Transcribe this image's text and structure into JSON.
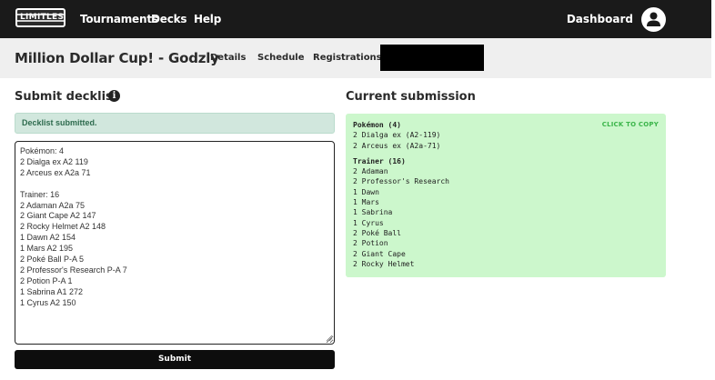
{
  "nav": {
    "logo_text": "LIMITLESS",
    "links": [
      "Tournaments",
      "Decks",
      "Help"
    ],
    "dashboard": "Dashboard",
    "user_icon": "user-icon"
  },
  "tournament": {
    "name": "Million Dollar Cup! - Godzly",
    "tabs": [
      "Details",
      "Schedule",
      "Registrations"
    ]
  },
  "submit_section": {
    "title": "Submit decklist",
    "info_icon": "info-icon",
    "alert": "Decklist submitted.",
    "decklist_value": "Pokémon: 4\n2 Dialga ex A2 119\n2 Arceus ex A2a 71\n\nTrainer: 16\n2 Adaman A2a 75\n2 Giant Cape A2 147\n2 Rocky Helmet A2 148\n1 Dawn A2 154\n1 Mars A2 195\n2 Poké Ball P-A 5\n2 Professor's Research P-A 7\n2 Potion P-A 1\n1 Sabrina A1 272\n1 Cyrus A2 150",
    "submit_label": "Submit"
  },
  "current_section": {
    "title": "Current submission",
    "copy_label": "CLICK TO COPY",
    "groups": [
      {
        "heading": "Pokémon (4)",
        "cards": [
          "2 Dialga ex (A2-119)",
          "2 Arceus ex (A2a-71)"
        ]
      },
      {
        "heading": "Trainer (16)",
        "cards": [
          "2 Adaman",
          "2 Professor's Research",
          "1 Dawn",
          "1 Mars",
          "1 Sabrina",
          "1 Cyrus",
          "2 Poké Ball",
          "2 Potion",
          "2 Giant Cape",
          "2 Rocky Helmet"
        ]
      }
    ]
  },
  "colors": {
    "nav_bg": "#1a1a1a",
    "subheader_bg": "#efefef",
    "alert_bg": "#d1e7dd",
    "alert_text": "#2e6b4e",
    "submission_bg": "#ccf7cc",
    "copy_link": "#3bb54a",
    "button_bg": "#0d0d0d"
  }
}
